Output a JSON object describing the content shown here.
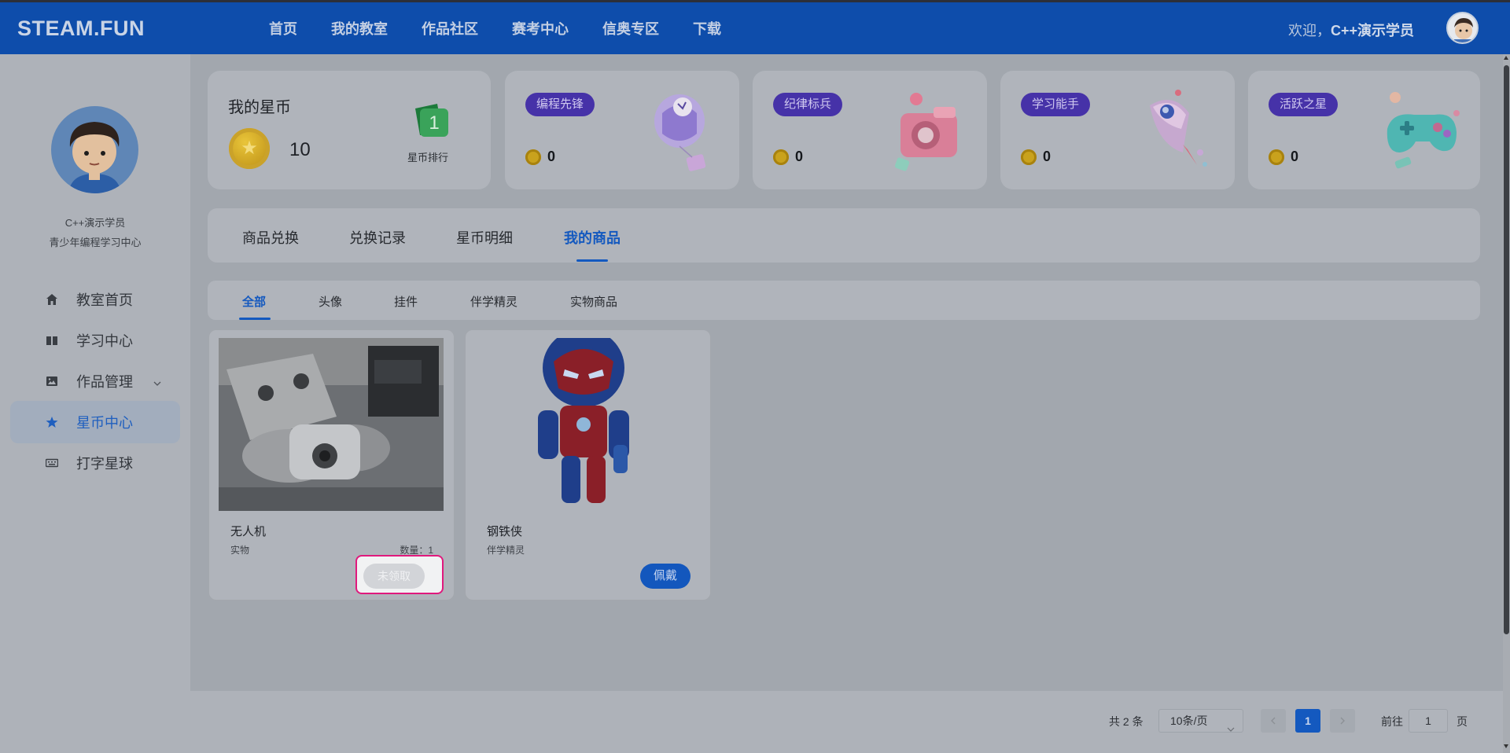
{
  "header": {
    "logo": "STEAM.FUN",
    "nav": [
      "首页",
      "我的教室",
      "作品社区",
      "赛考中心",
      "信奥专区",
      "下载"
    ],
    "welcome_prefix": "欢迎，",
    "username": "C++演示学员"
  },
  "sidebar": {
    "name": "C++演示学员",
    "org": "青少年编程学习中心",
    "items": [
      {
        "label": "教室首页",
        "icon": "home-icon"
      },
      {
        "label": "学习中心",
        "icon": "book-icon"
      },
      {
        "label": "作品管理",
        "icon": "image-icon"
      },
      {
        "label": "星币中心",
        "icon": "star-icon"
      },
      {
        "label": "打字星球",
        "icon": "keyboard-icon"
      }
    ]
  },
  "coins": {
    "title": "我的星币",
    "value": "10",
    "rank_number": "1",
    "rank_label": "星币排行"
  },
  "stats": [
    {
      "tag": "编程先锋",
      "value": "0"
    },
    {
      "tag": "纪律标兵",
      "value": "0"
    },
    {
      "tag": "学习能手",
      "value": "0"
    },
    {
      "tag": "活跃之星",
      "value": "0"
    }
  ],
  "tabs": [
    "商品兑换",
    "兑换记录",
    "星币明细",
    "我的商品"
  ],
  "subtabs": [
    "全部",
    "头像",
    "挂件",
    "伴学精灵",
    "实物商品"
  ],
  "products": [
    {
      "name": "无人机",
      "type": "实物",
      "qty": "数量：1",
      "button": "未领取"
    },
    {
      "name": "钢铁侠",
      "type": "伴学精灵",
      "button": "佩戴"
    }
  ],
  "pagination": {
    "total": "共 2 条",
    "page_size": "10条/页",
    "current": "1",
    "goto_label": "前往",
    "goto_value": "1",
    "page_suffix": "页"
  },
  "colors": {
    "header": "#0e4dab",
    "accent": "#1459bf",
    "tag": "#4632a8",
    "highlight": "#e0197d"
  }
}
